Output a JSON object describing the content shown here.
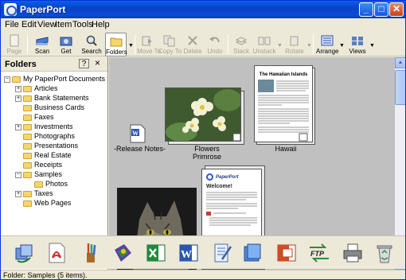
{
  "window": {
    "title": "PaperPort"
  },
  "menu": [
    "File",
    "Edit",
    "View",
    "Item",
    "Tools",
    "Help"
  ],
  "toolbar": {
    "page": "Page",
    "scan": "Scan",
    "get": "Get",
    "search": "Search",
    "folders": "Folders",
    "move_to": "Move To",
    "copy_to": "Copy To",
    "delete": "Delete",
    "undo": "Undo",
    "stack": "Stack",
    "unstack": "Unstack",
    "rotate": "Rotate",
    "arrange": "Arrange",
    "views": "Views"
  },
  "folders_pane": {
    "title": "Folders",
    "help_glyph": "?",
    "close_glyph": "×",
    "root": "My PaperPort Documents",
    "items": [
      "Articles",
      "Bank Statements",
      "Business Cards",
      "Faxes",
      "Investments",
      "Photographs",
      "Presentations",
      "Real Estate",
      "Receipts",
      "Samples",
      "Photos",
      "Taxes",
      "Web Pages"
    ]
  },
  "documents": {
    "release_notes": "-Release Notes-",
    "flowers": "Flowers",
    "primrose": "Primrose",
    "hawaii": "Hawaii",
    "hawaii_heading": "The Hawaiian Islands",
    "welcome_logo": "PaperPort",
    "welcome_heading": "Welcome!"
  },
  "apps": [
    "sync-icon",
    "pdf-icon",
    "paint-icon",
    "photo-editor-icon",
    "excel-icon",
    "word-icon",
    "notepad-icon",
    "scanner-icon",
    "powerpoint-icon",
    "ftp-icon",
    "printer-icon",
    "recycle-icon"
  ],
  "ftp_label": "FTP",
  "status": "Folder: Samples (5 items)."
}
